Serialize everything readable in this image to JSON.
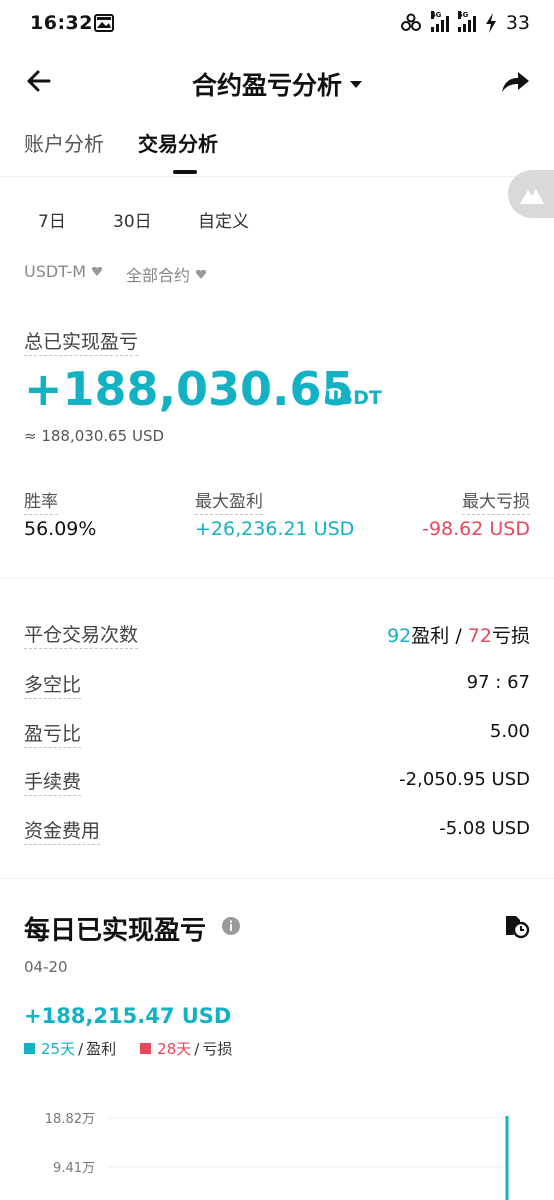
{
  "status_bar": {
    "time": "16:32",
    "network_1": "4G",
    "network_2": "5G",
    "battery": "33",
    "icons": [
      "image-icon",
      "link-icon",
      "signal-icon",
      "charging-icon"
    ]
  },
  "header": {
    "title": "合约盈亏分析",
    "icons": [
      "back-arrow-icon",
      "caret-down-icon",
      "share-icon"
    ]
  },
  "tabs": [
    {
      "label": "账户分析",
      "active": false
    },
    {
      "label": "交易分析",
      "active": true
    }
  ],
  "periods": [
    "7日",
    "30日",
    "自定义"
  ],
  "filters": [
    "USDT-M",
    "全部合约"
  ],
  "pnl": {
    "label": "总已实现盈亏",
    "value": "+188,030.65",
    "unit": "USDT",
    "approx": "≈ 188,030.65 USD"
  },
  "stats": {
    "win_rate_label": "胜率",
    "win_rate": "56.09%",
    "max_profit_label": "最大盈利",
    "max_profit": "+26,236.21 USD",
    "max_loss_label": "最大亏损",
    "max_loss": "-98.62 USD"
  },
  "details": {
    "trades_label": "平仓交易次数",
    "wins": "92",
    "wins_label": "盈利",
    "slash": "/",
    "losses": "72",
    "losses_label": "亏损",
    "long_short_label": "多空比",
    "long_short": "97 : 67",
    "pl_ratio_label": "盈亏比",
    "pl_ratio": "5.00",
    "fee_label": "手续费",
    "fee": "-2,050.95 USD",
    "funding_label": "资金费用",
    "funding": "-5.08 USD"
  },
  "daily": {
    "title": "每日已实现盈亏",
    "date": "04-20",
    "value": "+188,215.47 USD",
    "profit_days": "25天",
    "profit_label": "盈利",
    "loss_days": "28天",
    "loss_label": "亏损",
    "slash": "/",
    "icons": [
      "info-icon",
      "history-icon"
    ]
  },
  "colors": {
    "accent": "#12b2c4",
    "loss": "#e9485c",
    "text": "#111111",
    "muted": "#888888"
  },
  "chart_data": {
    "type": "line",
    "tick_labels": [
      "18.82万",
      "9.41万"
    ],
    "visible_y_ticks": [
      188200,
      94100
    ]
  }
}
